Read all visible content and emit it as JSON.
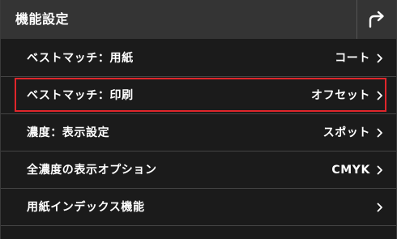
{
  "header": {
    "title": "機能設定",
    "back_icon": "return-arrow-icon"
  },
  "colors": {
    "header_bg": "#343434",
    "list_bg": "#1b1b1b",
    "divider": "#444444",
    "selection": "#e0262b",
    "text": "#ffffff"
  },
  "menu": {
    "items": [
      {
        "label": "ベストマッチ：用紙",
        "value": "コート",
        "selected": false
      },
      {
        "label": "ベストマッチ：印刷",
        "value": "オフセット",
        "selected": true
      },
      {
        "label": "濃度：表示設定",
        "value": "スポット",
        "selected": false
      },
      {
        "label": "全濃度の表示オプション",
        "value": "CMYK",
        "selected": false
      },
      {
        "label": "用紙インデックス機能",
        "value": "",
        "selected": false
      }
    ],
    "chevron_icon": "chevron-right-icon"
  }
}
